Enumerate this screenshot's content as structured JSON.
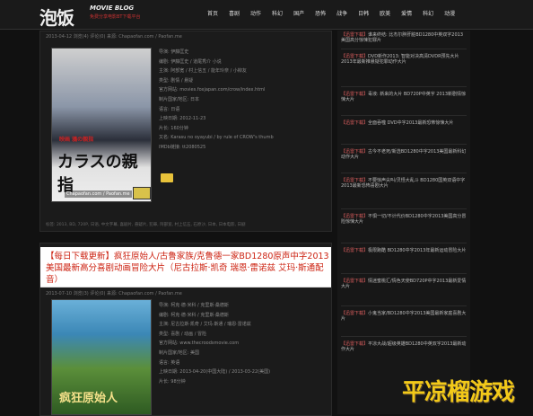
{
  "header": {
    "logo_zh": "泡饭",
    "logo_en": "MOVIE BLOG",
    "tagline": "免费分享电影BT下载平台",
    "nav": [
      "首页",
      "喜剧",
      "动作",
      "科幻",
      "国产",
      "恐怖",
      "战争",
      "日韩",
      "欧美",
      "爱情",
      "科幻",
      "动漫"
    ]
  },
  "posts": [
    {
      "meta": "2013-04-12 浏览(4) 评论(0) 来源: Chapaofan.com / Paofan.me",
      "poster_sub": "映画 鴉の親指",
      "poster_title": "カラスの親指",
      "poster_credit": "Chapaofan.com / Paofan.me",
      "info": [
        "导演: 伊藤匡史",
        "编剧: 伊藤匡史 / 道尾秀介 小说",
        "主演: 阿部宽 / 村上信五 / 能年玲奈 / 小柳友",
        "类型: 剧情 / 悬疑",
        "官方网站: movies.foxjapan.com/crow/index.html",
        "制片国家/地区: 日本",
        "语言: 日语",
        "上映日期: 2012-11-23",
        "片长: 160分钟",
        "又名: Karasu no oyayubi / by rule of CROW's thumb",
        "IMDb链接: tt2080525"
      ],
      "tagline": "标签: 2013, BD, 720P, 日语, 中文字幕, 喜剧片, 悬疑片, 犯罪, 阿部宽, 村上信五, 石原沙, 日本, 日本电影, 日剧"
    },
    {
      "banner": "【每日下载更新】疯狂原始人/古鲁家族/克鲁德一家BD1280原声中字2013美国最新高分喜剧动画冒险大片（尼古拉斯·凯奇 瑞恩·雷诺兹 艾玛·斯通配音）",
      "meta": "2013-07-10 浏览(3) 评论(0) 来源: Chapaofan.com / Paofan.me",
      "poster_title": "疯狂原始人",
      "info": [
        "导演: 柯克·德·米科 / 克里斯·桑德斯",
        "编剧: 柯克·德·米科 / 克里斯·桑德斯",
        "主演: 尼古拉斯·凯奇 / 艾玛·斯通 / 瑞恩·雷诺兹",
        "类型: 喜剧 / 动画 / 冒险",
        "官方网站: www.thecroodsmovie.com",
        "制片国家/地区: 美国",
        "语言: 英语",
        "上映日期: 2013-04-20(中国大陆) / 2013-03-22(美国)",
        "片长: 98分钟"
      ]
    }
  ],
  "sidebar": [
    {
      "tag": "【迅雷下载】",
      "text": "谁来终结: 比杰尔胖肝脏BD1280中英双字2013美国高分惊悚犯罪片"
    },
    {
      "tag": "【迅雷下载】",
      "text": "DVD新作2013: 智能对决高清DVDR预先大片2013年最新推悬疑犯罪动作大片"
    },
    {
      "tag": "【迅雷下载】",
      "text": "毒液: 新来的大片 BD720P中英字 2013新剧情惊悚大片"
    },
    {
      "tag": "【迅雷下载】",
      "text": "全面吞噬 DVD中字2013最新恐怖惊悚大片"
    },
    {
      "tag": "【迅雷下载】",
      "text": "古今不老死/新选BD1280中字2013美国最新科幻动作大片"
    },
    {
      "tag": "【迅雷下载】",
      "text": "不要惊声尖叫/灵怪大乱斗 BD1280国英双语中字2013最新恐怖喜剧大片"
    },
    {
      "tag": "【迅雷下载】",
      "text": "不惧一切/不计代价BD1280中字2013美国高分冒险惊悚大片"
    },
    {
      "tag": "【迅雷下载】",
      "text": "极限跑酷 BD1280中字2013年最新运动冒险大片"
    },
    {
      "tag": "【迅雷下载】",
      "text": "情迷蜜桃汇/情色天使BD720P中字2013最新爱情大片"
    },
    {
      "tag": "【迅雷下载】",
      "text": "小鬼当家/BD1280中字2013美国最新家庭喜剧大片"
    },
    {
      "tag": "【迅雷下载】",
      "text": "平凉大战/超级英雄BD1280中英双字2013最新动作大片"
    }
  ],
  "watermark": "平凉榴游戏"
}
